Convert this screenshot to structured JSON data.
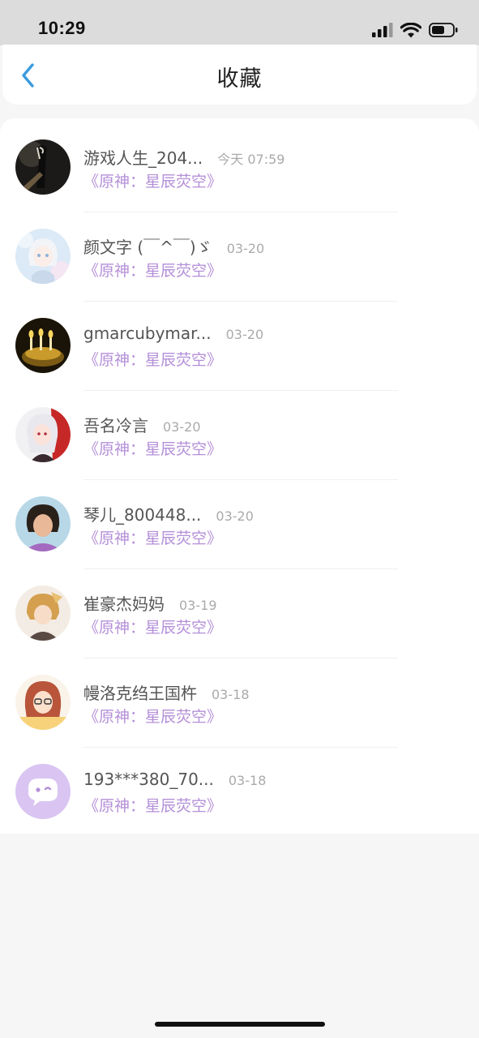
{
  "status_bar": {
    "time": "10:29"
  },
  "header": {
    "title": "收藏",
    "back_icon": "chevron-left-icon"
  },
  "colors": {
    "accent": "#3a9be0",
    "work_title": "#b48fd8"
  },
  "favorites": [
    {
      "name": "游戏人生_204...",
      "time": "今天 07:59",
      "work": "《原神：星辰荧空》"
    },
    {
      "name": "颜文字 (￣^￣)ゞ",
      "time": "03-20",
      "work": "《原神：星辰荧空》"
    },
    {
      "name": "gmarcubymar...",
      "time": "03-20",
      "work": "《原神：星辰荧空》"
    },
    {
      "name": "吾名冷言",
      "time": "03-20",
      "work": "《原神：星辰荧空》"
    },
    {
      "name": "琴儿_800448...",
      "time": "03-20",
      "work": "《原神：星辰荧空》"
    },
    {
      "name": "崔豪杰妈妈",
      "time": "03-19",
      "work": "《原神：星辰荧空》"
    },
    {
      "name": "幔洛克绉王国杵",
      "time": "03-18",
      "work": "《原神：星辰荧空》"
    },
    {
      "name": "193***380_70...",
      "time": "03-18",
      "work": "《原神：星辰荧空》"
    }
  ]
}
